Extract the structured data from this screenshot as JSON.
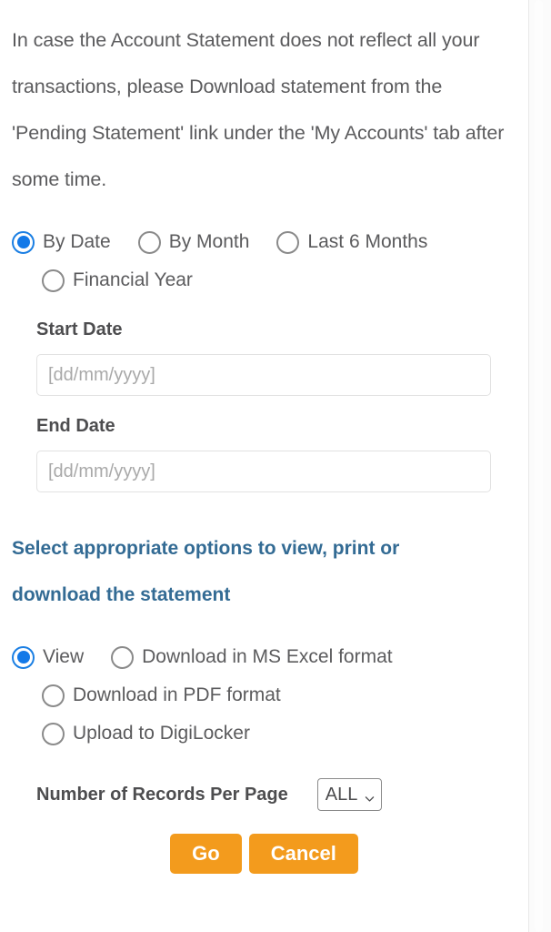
{
  "page": {
    "intro_text": "In case the Account Statement does not reflect all your transactions, please Download statement from the 'Pending Statement' link under the 'My Accounts' tab after some time.",
    "section_heading": "Select appropriate options to view, print or download the statement"
  },
  "period_options": [
    {
      "label": "By Date",
      "selected": true
    },
    {
      "label": "By Month",
      "selected": false
    },
    {
      "label": "Last 6 Months",
      "selected": false
    },
    {
      "label": "Financial Year",
      "selected": false
    }
  ],
  "date_fields": {
    "start": {
      "label": "Start Date",
      "value": "",
      "placeholder": "[dd/mm/yyyy]"
    },
    "end": {
      "label": "End Date",
      "value": "",
      "placeholder": "[dd/mm/yyyy]"
    }
  },
  "output_options": [
    {
      "label": "View",
      "selected": true
    },
    {
      "label": "Download in MS Excel format",
      "selected": false
    },
    {
      "label": "Download in PDF format",
      "selected": false
    },
    {
      "label": "Upload to DigiLocker",
      "selected": false
    }
  ],
  "records": {
    "label": "Number of Records Per Page",
    "selected_value": "ALL"
  },
  "buttons": {
    "go": "Go",
    "cancel": "Cancel"
  },
  "colors": {
    "accent_blue": "#1379e8",
    "heading_blue": "#336b94",
    "button_orange": "#f39b1d",
    "text_gray": "#5b5b5d"
  }
}
